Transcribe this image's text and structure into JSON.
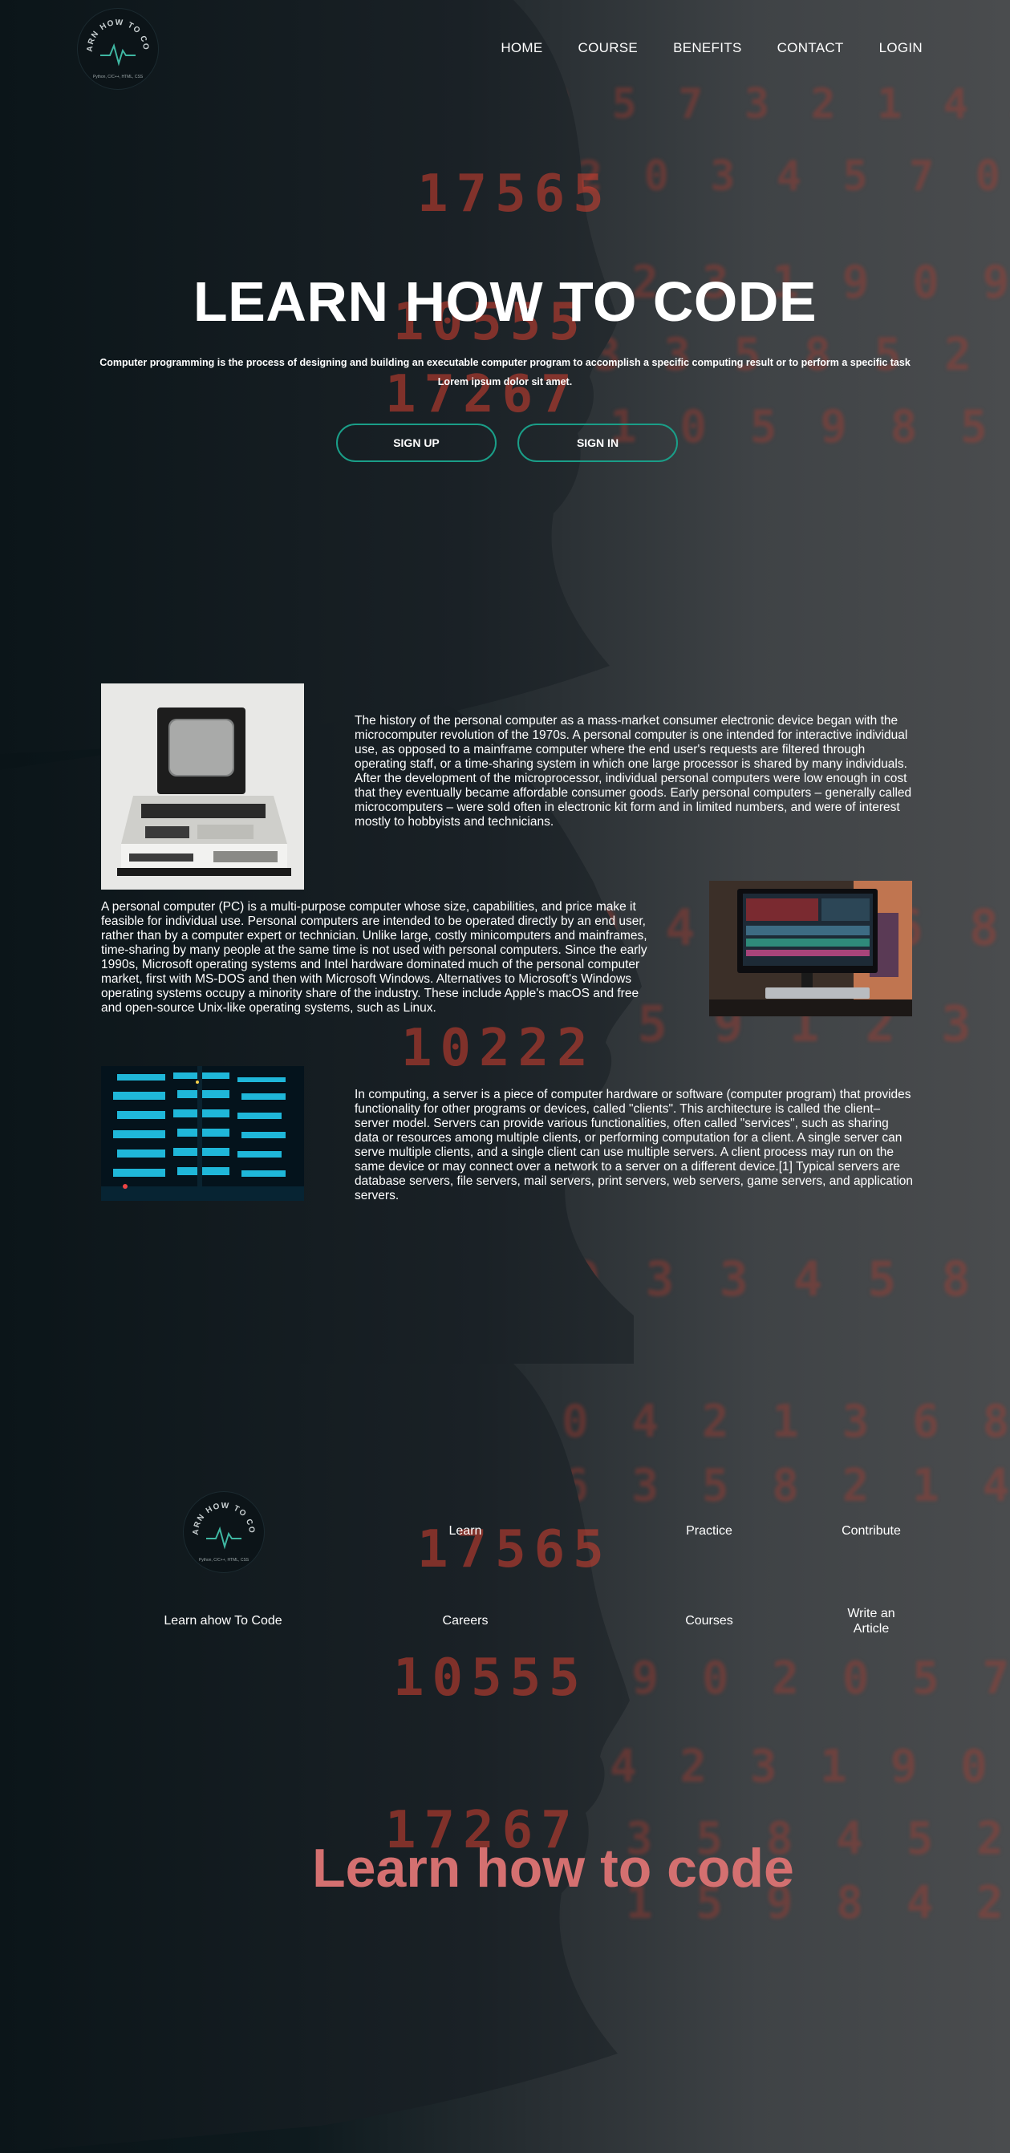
{
  "brand": {
    "logo_text": "LEARN HOW TO CODE",
    "logo_subtext": "Python, C/C++, HTML, CSS"
  },
  "nav": {
    "items": [
      "HOME",
      "COURSE",
      "BENEFITS",
      "CONTACT",
      "LOGIN"
    ]
  },
  "hero": {
    "title": "LEARN HOW TO CODE",
    "subtitle": "Computer programming is the process of designing and building an executable computer program to accomplish a specific computing result or to perform a specific task",
    "subtitle_line2": "Lorem ipsum dolor sit amet.",
    "signup_label": "SIGN UP",
    "signin_label": "SIGN IN"
  },
  "sections": {
    "pc_history": "The history of the personal computer as a mass-market consumer electronic device began with the microcomputer revolution of the 1970s. A personal computer is one intended for interactive individual use, as opposed to a mainframe computer where the end user's requests are filtered through operating staff, or a time-sharing system in which one large processor is shared by many individuals. After the development of the microprocessor, individual personal computers were low enough in cost that they eventually became affordable consumer goods. Early personal computers – generally called microcomputers – were sold often in electronic kit form and in limited numbers, and were of interest mostly to hobbyists and technicians.",
    "pc_definition": "A personal computer (PC) is a multi-purpose computer whose size, capabilities, and price make it feasible for individual use. Personal computers are intended to be operated directly by an end user, rather than by a computer expert or technician. Unlike large, costly minicomputers and mainframes, time-sharing by many people at the same time is not used with personal computers. Since the early 1990s, Microsoft operating systems and Intel hardware dominated much of the personal computer market, first with MS-DOS and then with Microsoft Windows. Alternatives to Microsoft's Windows operating systems occupy a minority share of the industry. These include Apple's macOS and free and open-source Unix-like operating systems, such as Linux.",
    "server": "In computing, a server is a piece of computer hardware or software (computer program) that provides functionality for other programs or devices, called \"clients\". This architecture is called the client–server model. Servers can provide various functionalities, often called \"services\", such as sharing data or resources among multiple clients, or performing computation for a client. A single server can serve multiple clients, and a single client can use multiple servers. A client process may run on the same device or may connect over a network to a server on a different device.[1] Typical servers are database servers, file servers, mail servers, print servers, web servers, game servers, and application servers."
  },
  "footer": {
    "links_row1": [
      "Learn",
      "Practice",
      "Contribute"
    ],
    "links_row2": [
      "Learn ahow To Code",
      "Careers",
      "Courses",
      "Write an Article"
    ],
    "tagline": "Learn how to code"
  },
  "colors": {
    "accent_teal": "#1a9e88",
    "tagline_pink": "#d47070",
    "digit_red": "#d64030"
  },
  "background_digits": [
    "17565",
    "10555",
    "17267",
    "10222"
  ]
}
